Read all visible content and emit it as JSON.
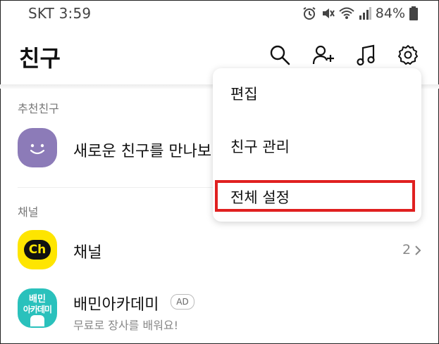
{
  "status": {
    "carrier_time": "SKT 3:59",
    "battery": "84%"
  },
  "header": {
    "title": "친구",
    "icons": [
      "search-icon",
      "add-friend-icon",
      "music-icon",
      "settings-icon"
    ]
  },
  "sections": {
    "recommend_label": "추천친구",
    "recommend_item": "새로운 친구를 만나보",
    "channel_label": "채널",
    "channel_item": "채널",
    "channel_count": "2",
    "channel_logo_text": "Ch",
    "academy_title": "배민아카데미",
    "academy_badge": "AD",
    "academy_subtitle": "무료로 장사를 배워요!",
    "academy_logo_line1": "배민",
    "academy_logo_line2": "아카데미"
  },
  "menu": {
    "items": [
      "편집",
      "친구 관리",
      "전체 설정"
    ],
    "highlighted_index": 2
  },
  "colors": {
    "kakao_yellow": "#FEE500",
    "avatar_purple": "#8C7BB8",
    "baemin_mint": "#2AC1BC",
    "highlight_red": "#E02020"
  }
}
